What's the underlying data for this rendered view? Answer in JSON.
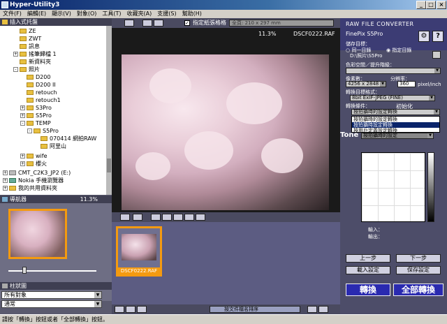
{
  "window": {
    "title": "Hyper-Utility3"
  },
  "menu": [
    "文件(F)",
    "編輯(E)",
    "顯示(V)",
    "對象(O)",
    "工具(T)",
    "收藏夾(A)",
    "支援(S)",
    "幫助(H)"
  ],
  "folder_panel": {
    "title": "插入式托盤"
  },
  "tree": [
    {
      "label": "ZE"
    },
    {
      "label": "ZWT"
    },
    {
      "label": "訊息"
    },
    {
      "label": "搖筆歸檔 1"
    },
    {
      "label": "新資料夾"
    },
    {
      "label": "照片"
    },
    {
      "label": "D200"
    },
    {
      "label": "D200 II"
    },
    {
      "label": "retouch"
    },
    {
      "label": "retouch1"
    },
    {
      "label": "S3Pro"
    },
    {
      "label": "S5Pro"
    },
    {
      "label": "TEMP"
    },
    {
      "label": "S5Pro"
    },
    {
      "label": "070414 網拍RAW"
    },
    {
      "label": "阿里山"
    },
    {
      "label": "wife"
    },
    {
      "label": "櫻火"
    },
    {
      "label": "CMT_C2K3_JP2 (E:)"
    },
    {
      "label": "Nokia 手機瀏覽器"
    },
    {
      "label": "我的共用資料夾"
    }
  ],
  "navigator": {
    "title": "導航器",
    "zoom": "11.3%"
  },
  "attributes": {
    "title": "柱狀圖",
    "combo1": "所有對象",
    "combo2": "通常"
  },
  "toolbar": {
    "fit_paper_label": "指定紙張格格",
    "paper_size": "全頁: 210 x 297 mm"
  },
  "viewer": {
    "zoom": "11.3%",
    "filename": "DSCF0222.RAF"
  },
  "thumbnail": {
    "filename": "DSCF0222.RAF"
  },
  "sort": {
    "label": "按文件檔名排序"
  },
  "converter": {
    "title": "RAW FILE CONVERTER",
    "camera": "FinePix S5Pro",
    "save_dest_label": "儲存目標：",
    "opt_same": "同一目錄",
    "opt_specified": "指定目錄",
    "path": "D:\\照片\\S5Pro",
    "color_label": "色彩空間／提升階級：",
    "pixels_label": "像素數：",
    "pixels_value": "4256 x 2848",
    "resolution_label": "分辨率：",
    "resolution_value": "360",
    "resolution_unit": "pixel/inch",
    "format_label": "轉換目標格式：",
    "format_value": "8bit ExIF-JPEG (FINE)",
    "conversion_label": "轉換條件：",
    "init_label": "初始化",
    "conversion_value": "按拍攝時的設定轉換",
    "dropdown_options": [
      "按拍攝時的設定轉換",
      "按拍攝時設定轉換",
      "按用戶定義設定轉換"
    ],
    "tone_label": "Tone",
    "tone_combo": "按拍攝時的設定",
    "input_label": "輸入：",
    "output_label": "輸出：",
    "prev_step": "上一步",
    "next_step": "下一步",
    "load_settings": "載入設定",
    "save_settings": "保存設定",
    "convert": "轉換",
    "convert_all": "全部轉換"
  },
  "status": {
    "text": "請按「轉換」按鈕或者「全部轉換」按鈕。"
  },
  "colors": {
    "accent": "#f49a10",
    "panel": "#5c5c82",
    "button_blue": "#2a2ab0"
  }
}
